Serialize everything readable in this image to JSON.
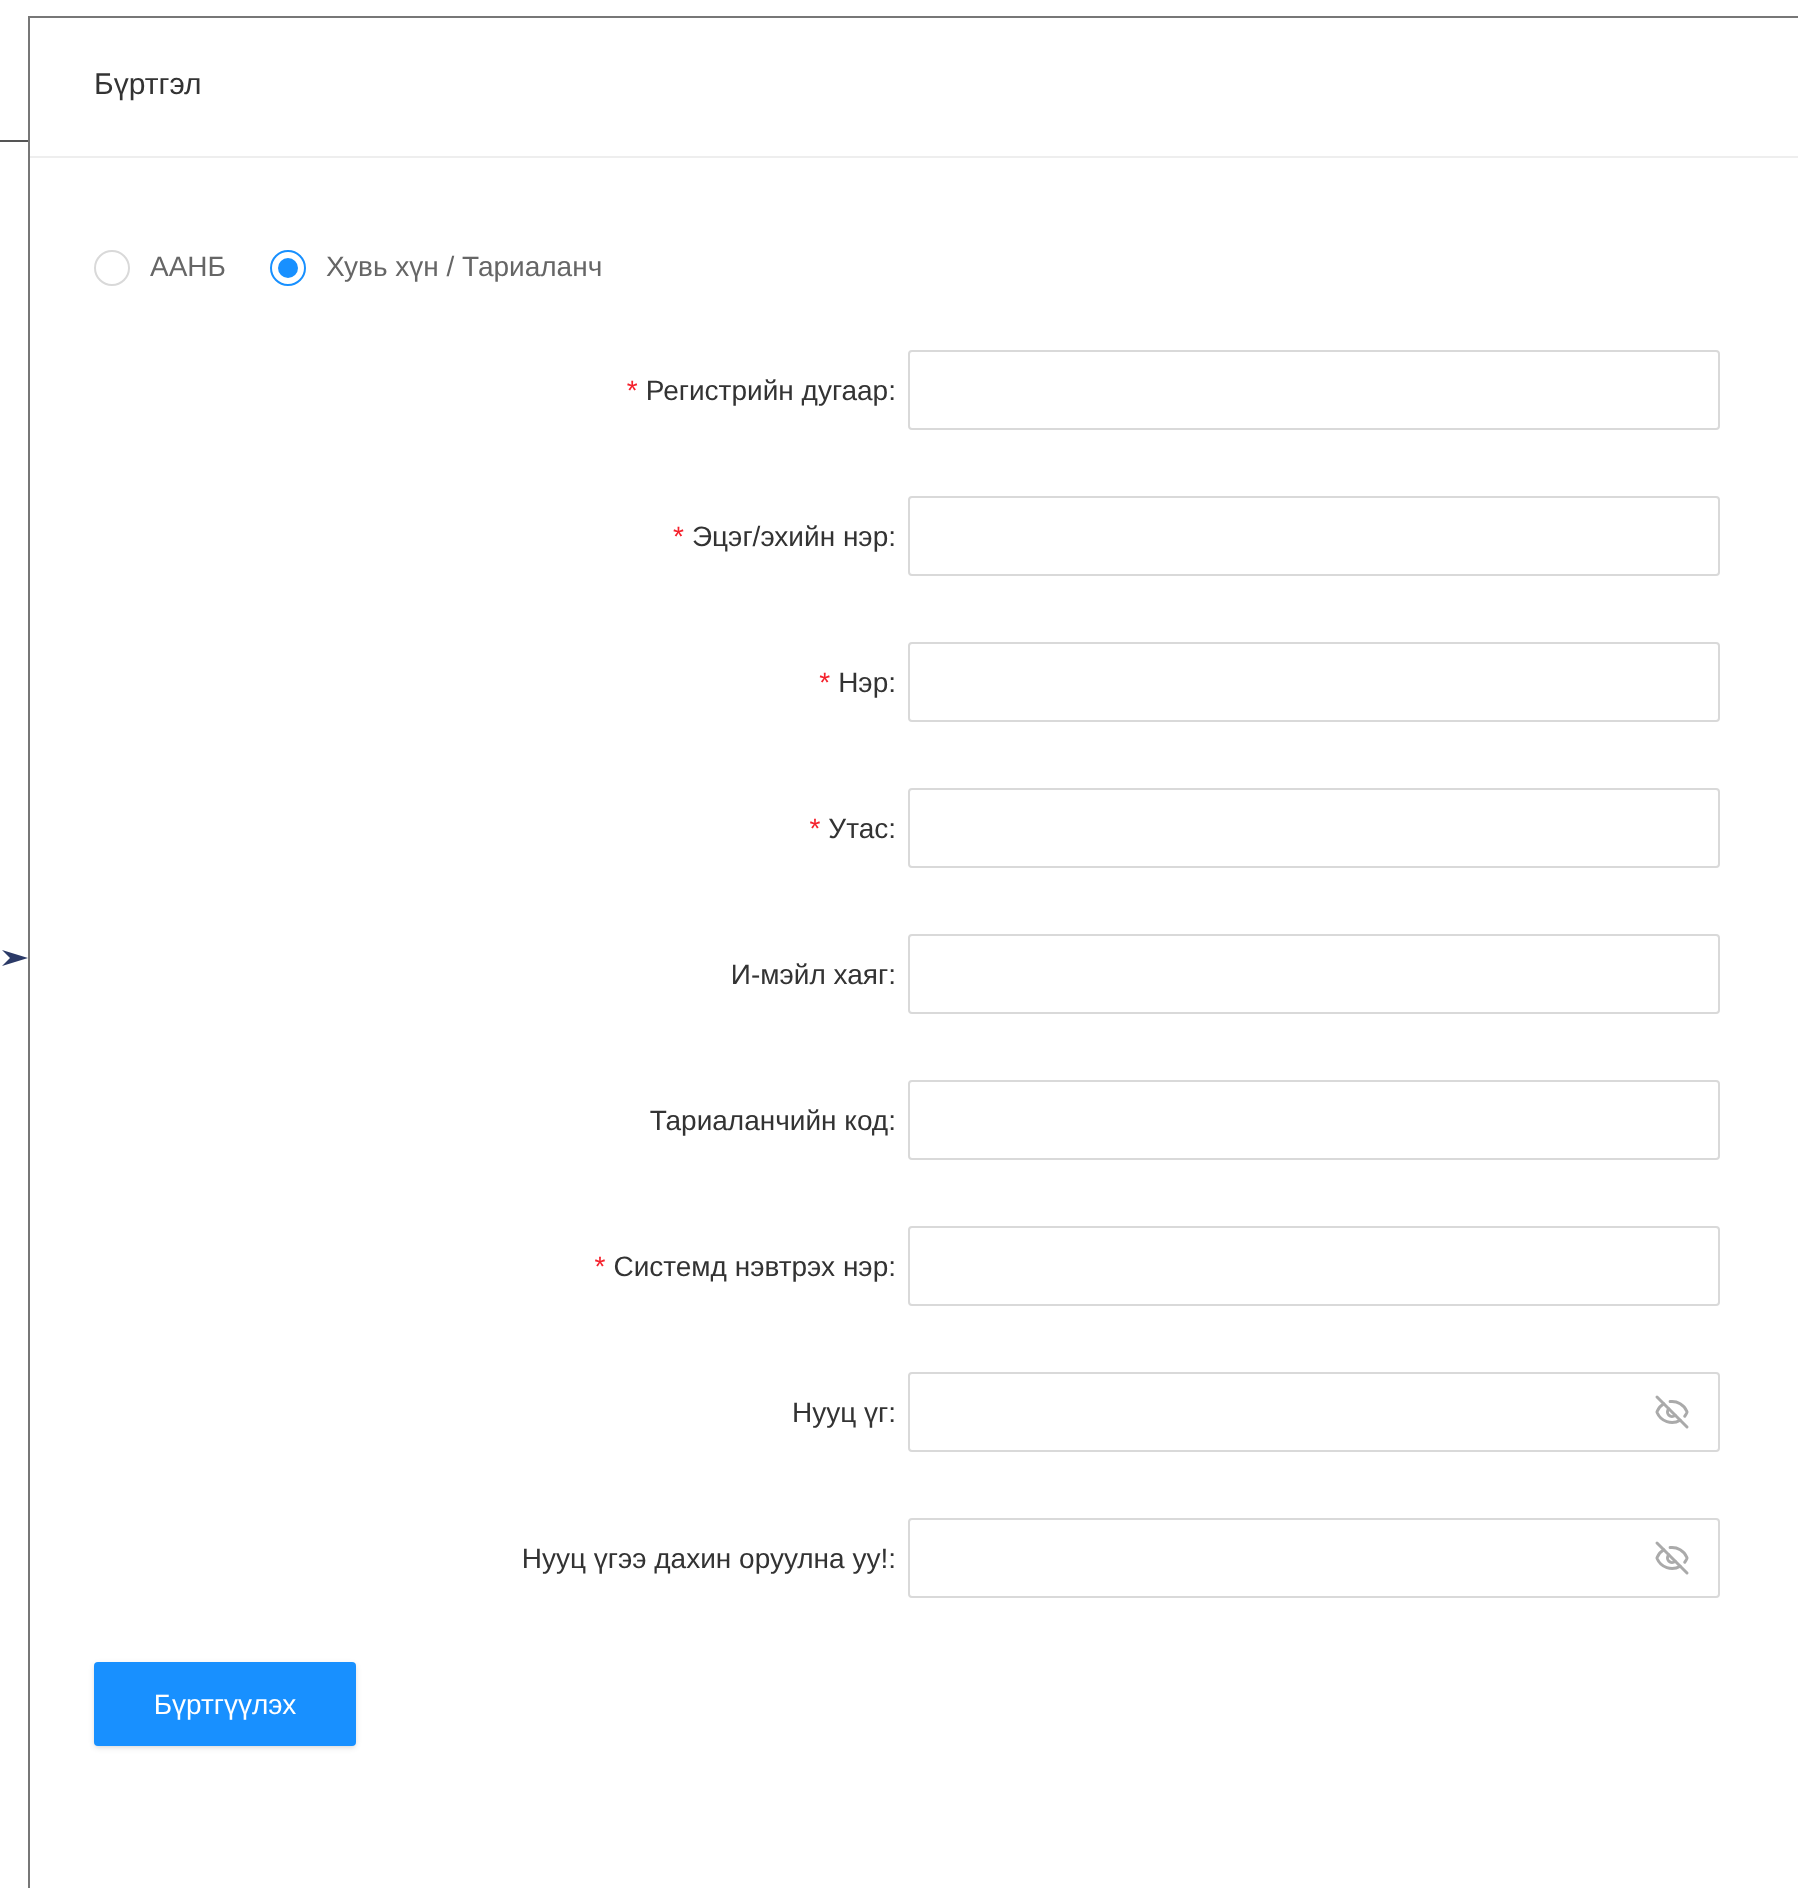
{
  "dialog": {
    "title": "Бүртгэл"
  },
  "account_types": [
    {
      "label": "ААНБ",
      "selected": false
    },
    {
      "label": "Хувь хүн / Тариаланч",
      "selected": true
    }
  ],
  "required_mark": "*",
  "fields": [
    {
      "label": "Регистрийн дугаар:",
      "required": true,
      "kind": "text"
    },
    {
      "label": "Эцэг/эхийн нэр:",
      "required": true,
      "kind": "text"
    },
    {
      "label": "Нэр:",
      "required": true,
      "kind": "text"
    },
    {
      "label": "Утас:",
      "required": true,
      "kind": "text"
    },
    {
      "label": "И-мэйл хаяг:",
      "required": false,
      "kind": "text"
    },
    {
      "label": "Тариаланчийн код:",
      "required": false,
      "kind": "text"
    },
    {
      "label": "Системд нэвтрэх нэр:",
      "required": true,
      "kind": "text"
    },
    {
      "label": "Нууц үг:",
      "required": false,
      "kind": "password"
    },
    {
      "label": "Нууц үгээ дахин оруулна уу!:",
      "required": false,
      "kind": "password"
    }
  ],
  "submit_button": "Бүртгүүлэх"
}
